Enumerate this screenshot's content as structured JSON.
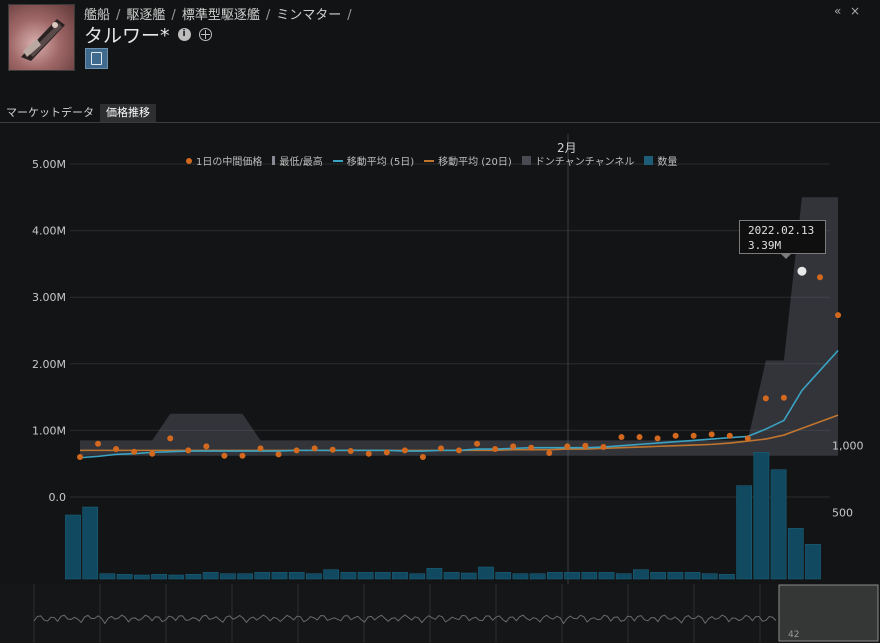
{
  "header": {
    "breadcrumb": [
      "艦船",
      "駆逐艦",
      "標準型駆逐艦",
      "ミンマター"
    ],
    "separator": "/",
    "title": "タルワー*",
    "controls": {
      "collapse": "«",
      "close": "×"
    }
  },
  "tabs": [
    {
      "label": "マーケットデータ",
      "active": false
    },
    {
      "label": "価格推移",
      "active": true
    }
  ],
  "legend": [
    {
      "label": "1日の中間価格",
      "kind": "dot",
      "color": "#d2691e"
    },
    {
      "label": "最低/最高",
      "kind": "bar",
      "color": "#8a8a94"
    },
    {
      "label": "移動平均 (5日)",
      "kind": "line",
      "color": "#3aa3c3"
    },
    {
      "label": "移動平均 (20日)",
      "kind": "line",
      "color": "#c0752f"
    },
    {
      "label": "ドンチャンチャンネル",
      "kind": "box",
      "color": "#4a4a52"
    },
    {
      "label": "数量",
      "kind": "box",
      "color": "#1d5d78"
    }
  ],
  "tooltip": {
    "date": "2022.02.13",
    "value": "3.39M"
  },
  "chart_data": {
    "type": "line",
    "month_label": "2月",
    "price_axis": {
      "ticks": [
        "0.0",
        "1.00M",
        "2.00M",
        "3.00M",
        "4.00M",
        "5.00M"
      ],
      "ylim": [
        0,
        5000000
      ]
    },
    "volume_axis": {
      "ticks": [
        "500",
        "1,000"
      ],
      "ylim": [
        0,
        1500
      ]
    },
    "x": [
      1,
      2,
      3,
      4,
      5,
      6,
      7,
      8,
      9,
      10,
      11,
      12,
      13,
      14,
      15,
      16,
      17,
      18,
      19,
      20,
      21,
      22,
      23,
      24,
      25,
      26,
      27,
      28,
      29,
      30,
      31,
      32,
      33,
      34,
      35,
      36,
      37,
      38,
      39,
      40,
      41,
      42
    ],
    "series": [
      {
        "name": "1日の中間価格",
        "values": [
          600000,
          800000,
          720000,
          680000,
          650000,
          880000,
          700000,
          760000,
          620000,
          620000,
          730000,
          640000,
          700000,
          730000,
          710000,
          690000,
          650000,
          670000,
          700000,
          600000,
          730000,
          700000,
          800000,
          720000,
          760000,
          740000,
          660000,
          760000,
          770000,
          750000,
          900000,
          900000,
          880000,
          920000,
          920000,
          940000,
          920000,
          880000,
          1480000,
          1490000,
          3390000,
          3300000,
          2730000
        ]
      },
      {
        "name": "移動平均 (5日)",
        "values": [
          590000,
          610000,
          640000,
          650000,
          670000,
          680000,
          690000,
          690000,
          690000,
          690000,
          690000,
          690000,
          700000,
          700000,
          700000,
          700000,
          700000,
          700000,
          690000,
          690000,
          700000,
          700000,
          720000,
          720000,
          730000,
          740000,
          740000,
          740000,
          740000,
          750000,
          770000,
          790000,
          810000,
          830000,
          850000,
          870000,
          890000,
          910000,
          1020000,
          1150000,
          1600000,
          1900000,
          2200000
        ]
      },
      {
        "name": "移動平均 (20日)",
        "values": [
          700000,
          700000,
          700000,
          700000,
          700000,
          700000,
          700000,
          700000,
          700000,
          700000,
          700000,
          700000,
          700000,
          700000,
          700000,
          700000,
          700000,
          700000,
          700000,
          700000,
          700000,
          700000,
          700000,
          700000,
          710000,
          710000,
          710000,
          720000,
          720000,
          730000,
          740000,
          750000,
          760000,
          770000,
          780000,
          790000,
          810000,
          840000,
          870000,
          930000,
          1030000,
          1130000,
          1230000
        ]
      },
      {
        "name": "数量",
        "values": [
          480,
          540,
          40,
          35,
          30,
          35,
          30,
          35,
          50,
          40,
          40,
          50,
          50,
          50,
          40,
          70,
          50,
          50,
          50,
          50,
          40,
          80,
          50,
          45,
          90,
          50,
          40,
          40,
          50,
          50,
          50,
          50,
          40,
          70,
          50,
          50,
          50,
          40,
          35,
          700,
          950,
          820,
          380,
          260
        ]
      }
    ],
    "low_high_band_upper": [
      850000,
      850000,
      850000,
      850000,
      850000,
      1250000,
      1250000,
      1250000,
      1250000,
      1250000,
      850000,
      850000,
      850000,
      850000,
      850000,
      850000,
      850000,
      850000,
      850000,
      850000,
      850000,
      850000,
      850000,
      850000,
      850000,
      850000,
      850000,
      850000,
      850000,
      850000,
      850000,
      850000,
      850000,
      850000,
      850000,
      850000,
      850000,
      850000,
      2050000,
      2050000,
      4500000,
      4500000,
      4500000
    ],
    "low_high_band_lower": [
      620000,
      620000,
      620000,
      620000,
      620000,
      620000,
      620000,
      620000,
      620000,
      620000,
      620000,
      620000,
      620000,
      620000,
      620000,
      620000,
      620000,
      620000,
      620000,
      620000,
      620000,
      620000,
      620000,
      620000,
      620000,
      620000,
      620000,
      620000,
      620000,
      620000,
      620000,
      620000,
      620000,
      620000,
      620000,
      620000,
      620000,
      620000,
      620000,
      620000,
      620000,
      620000,
      620000
    ],
    "grid": true
  }
}
